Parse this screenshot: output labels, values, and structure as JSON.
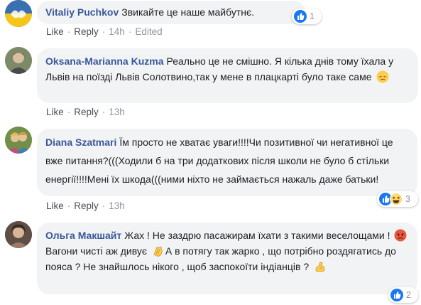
{
  "comments": [
    {
      "author": "Vitaliy Puchkov",
      "text": "Звикайте це наше майбутнє.",
      "actions": {
        "like": "Like",
        "reply": "Reply",
        "time": "14h",
        "edited": "Edited"
      },
      "reactions": {
        "icons": [
          "like-icon"
        ],
        "count": "1"
      },
      "avatar_colors": [
        "#f5c518",
        "#3a6fb0"
      ]
    },
    {
      "author": "Oksana-Marianna Kuzma",
      "text": "Реально це не смішно. Я кілька днів тому їхала у Львів на поїзді Львів Солотвино,так у мене в плацкарті було таке саме",
      "emoji": "pensive-emoji",
      "actions": {
        "like": "Like",
        "reply": "Reply",
        "time": "13h"
      },
      "avatar_colors": [
        "#8a8f7a",
        "#c9b89a"
      ]
    },
    {
      "author": "Diana Szatmari",
      "text": "Їм просто не хватає уваги!!!!Чи позитивної чи негативної це вже питання?(((Ходили б на три додаткових після школи не було б стільки енергії!!!!Мені їх шкода(((ними ніхто не займається нажаль даже батьки!",
      "actions": {
        "like": "Like",
        "reply": "Reply",
        "time": "13h"
      },
      "reactions": {
        "icons": [
          "like-icon",
          "haha-icon"
        ],
        "count": "3"
      },
      "avatar_colors": [
        "#d9a441",
        "#5b7c3c"
      ]
    },
    {
      "author": "Ольга Макшайт",
      "text_parts": [
        "Жах ! Не заздрю пасажирам їхати з такими веселощами !",
        "Вагони чисті аж дивує",
        "А в потягу так жарко , що потрібно роздягатись до пояса ? Не знайшлось нікого , щоб заспокоїти індіанців ?"
      ],
      "emojis": [
        "angry-emoji",
        "clapping-hands-emoji",
        "flexed-biceps-emoji"
      ],
      "reactions": {
        "icons": [
          "like-icon"
        ],
        "count": "2"
      },
      "avatar_colors": [
        "#6b5a4e",
        "#b08a72"
      ]
    }
  ]
}
